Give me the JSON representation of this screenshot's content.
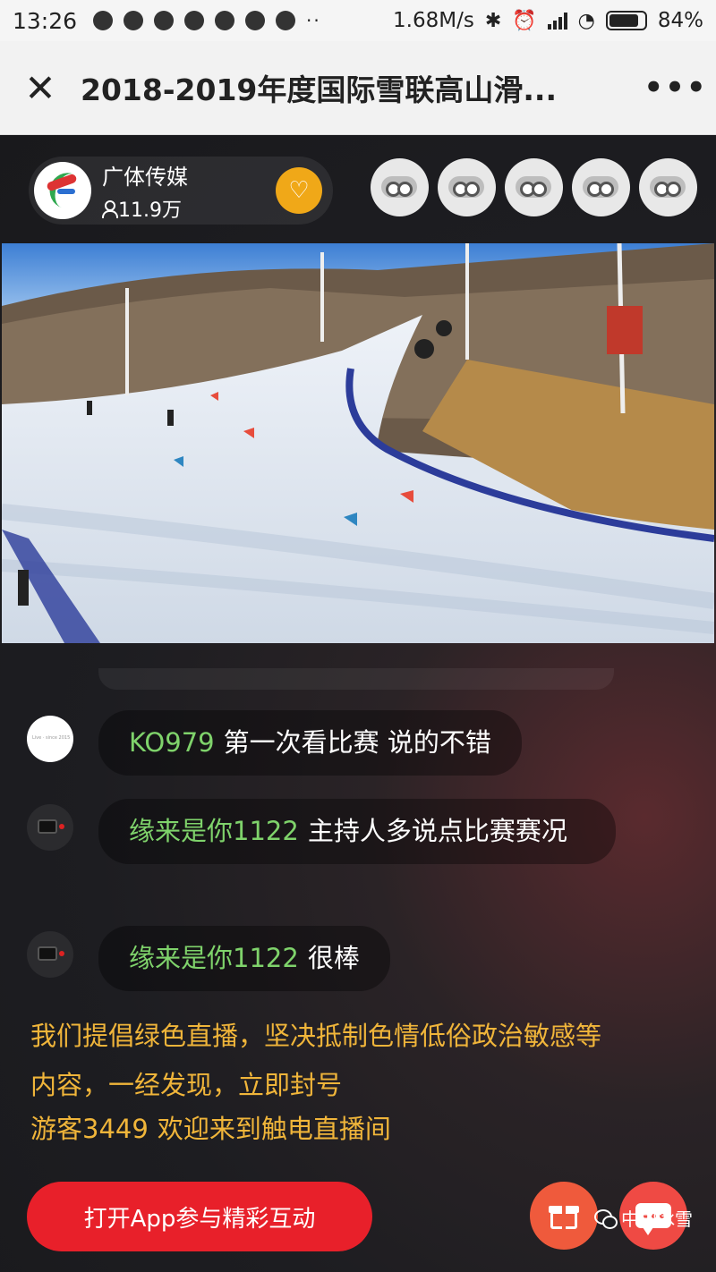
{
  "status_bar": {
    "time": "13:26",
    "dots": "··",
    "speed": "1.68M/s",
    "battery": "84%",
    "battery_level": 0.84
  },
  "title_bar": {
    "title": "2018-2019年度国际雪联高山滑...",
    "more": "•••"
  },
  "host": {
    "name": "广体传媒",
    "viewers": "11.9万"
  },
  "chat": [
    {
      "user": "KO979",
      "text": "第一次看比赛 说的不错"
    },
    {
      "user": "缘来是你1122",
      "text": "主持人多说点比赛赛况"
    },
    {
      "user": "缘来是你1122",
      "text": "很棒"
    }
  ],
  "notice": "我们提倡绿色直播，坚决抵制色情低俗政治敏感等内容，一经发现，立即封号",
  "welcome": {
    "guest": "游客3449",
    "text": "欢迎来到触电直播间"
  },
  "open_app_label": "打开App参与精彩互动",
  "watermark": "中国冰雪",
  "colors": {
    "username": "#7fd36b",
    "notice": "#f0b53a",
    "open_app": "#e8202a",
    "follow": "#f0a818"
  }
}
